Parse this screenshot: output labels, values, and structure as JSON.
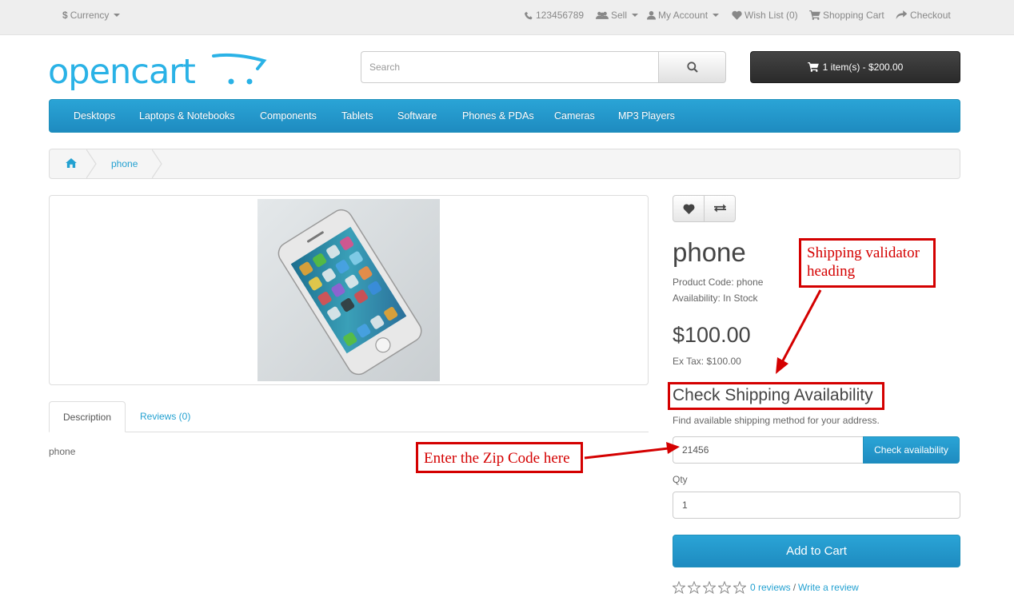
{
  "topbar": {
    "currency_label": "Currency",
    "phone": "123456789",
    "sell": "Sell",
    "my_account": "My Account",
    "wish_list": "Wish List (0)",
    "shopping_cart": "Shopping Cart",
    "checkout": "Checkout"
  },
  "header": {
    "logo_text": "opencart",
    "search_placeholder": "Search",
    "cart_summary": "1 item(s) - $200.00"
  },
  "menu": {
    "items": [
      "Desktops",
      "Laptops & Notebooks",
      "Components",
      "Tablets",
      "Software",
      "Phones & PDAs",
      "Cameras",
      "MP3 Players"
    ]
  },
  "breadcrumb": {
    "home_icon": "home-icon",
    "current": "phone"
  },
  "tabs": {
    "description": "Description",
    "reviews": "Reviews (0)",
    "description_text": "phone"
  },
  "product": {
    "title": "phone",
    "product_code": "Product Code: phone",
    "availability": "Availability: In Stock",
    "price": "$100.00",
    "ex_tax": "Ex Tax: $100.00"
  },
  "shipping": {
    "heading": "Check Shipping Availability",
    "description": "Find available shipping method for your address.",
    "zip_value": "21456",
    "check_button": "Check availability"
  },
  "cart_form": {
    "qty_label": "Qty",
    "qty_value": "1",
    "add_to_cart": "Add to Cart"
  },
  "rating": {
    "stars_filled": 0,
    "stars_total": 5,
    "reviews_link": "0 reviews",
    "separator": "/",
    "write_review": "Write a review"
  },
  "annotations": {
    "validator_heading": "Shipping validator heading",
    "zip_hint": "Enter the Zip Code here",
    "color": "#d40000"
  },
  "colors": {
    "brand_blue": "#23a1d1",
    "menu_blue": "#229ac8",
    "cart_dark": "#363636"
  }
}
